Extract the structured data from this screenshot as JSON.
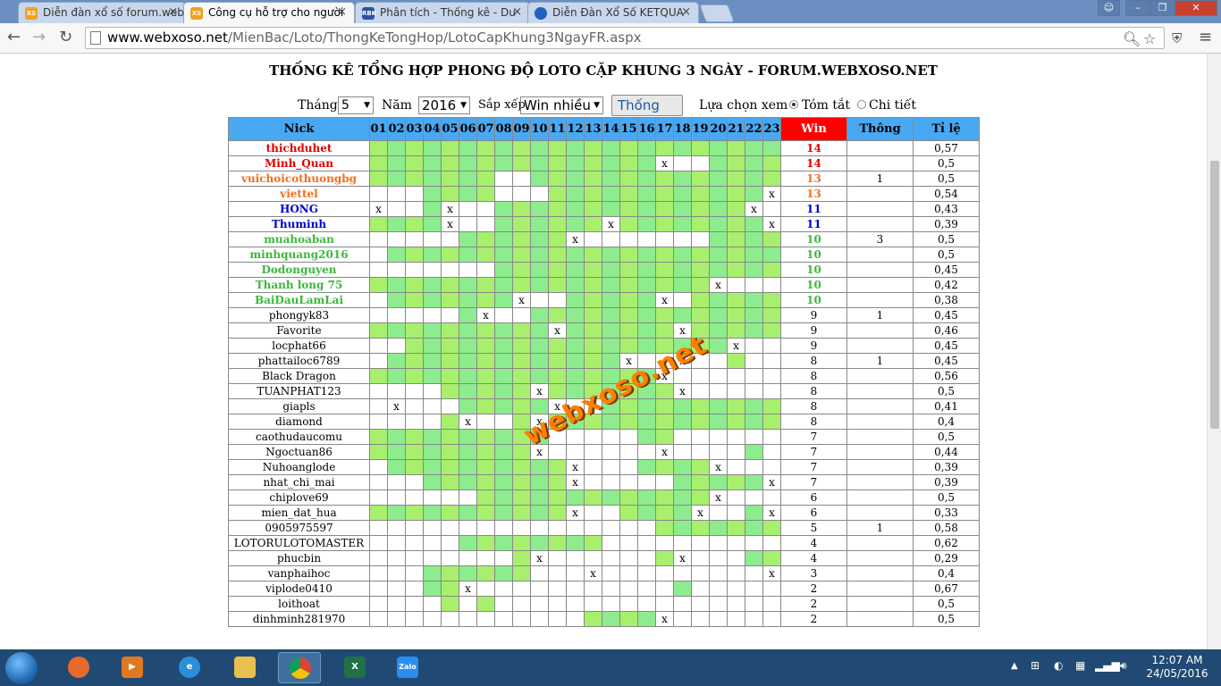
{
  "browser": {
    "tabs": [
      {
        "title": "Diễn đàn xổ số forum.web",
        "favicon": "XS",
        "color": "#f0a020",
        "active": false
      },
      {
        "title": "Công cụ hỗ trợ cho người",
        "favicon": "XS",
        "color": "#f0a020",
        "active": true
      },
      {
        "title": "Phân tích - Thống kê - Du",
        "favicon": "RBK",
        "color": "#3050a0",
        "active": false
      },
      {
        "title": "Diễn Đàn Xổ Số KETQUA",
        "favicon": "",
        "color": "#2060c0",
        "active": false
      }
    ],
    "url_host": "www.webxoso.net",
    "url_path": "/MienBac/Loto/ThongKeTongHop/LotoCapKhung3NgayFR.aspx"
  },
  "page": {
    "title": "THỐNG KÊ TỔNG HỢP PHONG ĐỘ LOTO CẶP KHUNG 3 NGÀY - FORUM.WEBXOSO.NET",
    "month_label": "Tháng",
    "month_value": "5",
    "year_label": "Năm",
    "year_value": "2016",
    "sort_label": "Sắp xếp",
    "sort_value": "Win nhiều",
    "submit_label": "Thống kê",
    "view_label": "Lựa chọn xem",
    "view_summary": "Tóm tắt",
    "view_detail": "Chi tiết",
    "watermark": "webxoso.net"
  },
  "table": {
    "headers": {
      "nick": "Nick",
      "win": "Win",
      "thong": "Thông",
      "ratio": "Tỉ lệ"
    },
    "days": [
      "01",
      "02",
      "03",
      "04",
      "05",
      "06",
      "07",
      "08",
      "09",
      "10",
      "11",
      "12",
      "13",
      "14",
      "15",
      "16",
      "17",
      "18",
      "19",
      "20",
      "21",
      "22",
      "23"
    ],
    "rows": [
      {
        "nick": "thichduhet",
        "color": "#e00000",
        "bold": true,
        "cells": "11111111111111111111112x",
        "win": "14",
        "thong": "",
        "ratio": "0,57"
      },
      {
        "nick": "Minh_Quan",
        "color": "#e00000",
        "bold": true,
        "cells": "1111111111111111x0011111",
        "win": "14",
        "thong": "",
        "ratio": "0,5"
      },
      {
        "nick": "vuichoicothuongbg",
        "color": "#f07020",
        "bold": true,
        "cells": "11111110011111111111111",
        "win": "13",
        "thong": "1",
        "ratio": "0,5"
      },
      {
        "nick": "viettel",
        "color": "#f07020",
        "bold": true,
        "cells": "0001111000111111111112x0",
        "win": "13",
        "thong": "",
        "ratio": "0,54"
      },
      {
        "nick": "HONG",
        "color": "#0000d0",
        "bold": true,
        "cells": "x001x0011111111111111x00",
        "win": "11",
        "thong": "",
        "ratio": "0,43"
      },
      {
        "nick": "Thuminh",
        "color": "#0000d0",
        "bold": true,
        "cells": "1111x00111111x11111112x0",
        "win": "11",
        "thong": "",
        "ratio": "0,39"
      },
      {
        "nick": "muahoaban",
        "color": "#3cb83c",
        "bold": true,
        "cells": "00000111111x0000000111111",
        "win": "10",
        "thong": "3",
        "ratio": "0,5"
      },
      {
        "nick": "minhquang2016",
        "color": "#3cb83c",
        "bold": true,
        "cells": "01111111111111111111112x0",
        "win": "10",
        "thong": "",
        "ratio": "0,5"
      },
      {
        "nick": "Dodonguyen",
        "color": "#3cb83c",
        "bold": true,
        "cells": "0000000111111111111111100x",
        "win": "10",
        "thong": "",
        "ratio": "0,45"
      },
      {
        "nick": "Thanh long 75",
        "color": "#3cb83c",
        "bold": true,
        "cells": "1111111111111111111x000x",
        "win": "10",
        "thong": "",
        "ratio": "0,42"
      },
      {
        "nick": "BaiDauLamLai",
        "color": "#3cb83c",
        "bold": true,
        "cells": "01111111x0011111x011111110",
        "win": "10",
        "thong": "",
        "ratio": "0,38"
      },
      {
        "nick": "phongyk83",
        "color": "#000",
        "bold": false,
        "cells": "000001x001111111111111111",
        "win": "9",
        "thong": "1",
        "ratio": "0,45"
      },
      {
        "nick": "Favorite",
        "color": "#000",
        "bold": false,
        "cells": "1111111111x111111x11111111",
        "win": "9",
        "thong": "",
        "ratio": "0,46"
      },
      {
        "nick": "locphat66",
        "color": "#000",
        "bold": false,
        "cells": "00111111111111111111x000",
        "win": "9",
        "thong": "",
        "ratio": "0,45"
      },
      {
        "nick": "phattailoc6789",
        "color": "#000",
        "bold": false,
        "cells": "01111111111111x00x001",
        "win": "8",
        "thong": "1",
        "ratio": "0,45"
      },
      {
        "nick": "Black Dragon",
        "color": "#000",
        "bold": false,
        "cells": "1111111111111111x000000",
        "win": "8",
        "thong": "",
        "ratio": "0,56"
      },
      {
        "nick": "TUANPHAT123",
        "color": "#000",
        "bold": false,
        "cells": "000011111x1111111x00000",
        "win": "8",
        "thong": "",
        "ratio": "0,5"
      },
      {
        "nick": "giapls",
        "color": "#000",
        "bold": false,
        "cells": "0x00011111x0011111111111x",
        "win": "8",
        "thong": "",
        "ratio": "0,41"
      },
      {
        "nick": "diamond",
        "color": "#000",
        "bold": false,
        "cells": "00001x001x1111111111111",
        "win": "8",
        "thong": "",
        "ratio": "0,4"
      },
      {
        "nick": "caothudaucomu",
        "color": "#000",
        "bold": false,
        "cells": "1111111111000001100000000",
        "win": "7",
        "thong": "",
        "ratio": "0,5"
      },
      {
        "nick": "Ngoctuan86",
        "color": "#000",
        "bold": false,
        "cells": "111111111x000000x0000100",
        "win": "7",
        "thong": "",
        "ratio": "0,44"
      },
      {
        "nick": "Nuhoanglode",
        "color": "#000",
        "bold": false,
        "cells": "01111111111x0001111x000000",
        "win": "7",
        "thong": "",
        "ratio": "0,39"
      },
      {
        "nick": "nhat_chi_mai",
        "color": "#000",
        "bold": false,
        "cells": "00011111111x0000011111x0",
        "win": "7",
        "thong": "",
        "ratio": "0,39"
      },
      {
        "nick": "chiplove69",
        "color": "#000",
        "bold": false,
        "cells": "0000001111111111111x00000",
        "win": "6",
        "thong": "",
        "ratio": "0,5"
      },
      {
        "nick": "mien_dat_hua",
        "color": "#000",
        "bold": false,
        "cells": "11111111111x001111x001x00",
        "win": "6",
        "thong": "",
        "ratio": "0,33"
      },
      {
        "nick": "0905975597",
        "color": "#000",
        "bold": false,
        "cells": "00000000000000001111111x0",
        "win": "5",
        "thong": "1",
        "ratio": "0,58"
      },
      {
        "nick": "LOTORULOTOMASTER",
        "color": "#000",
        "bold": false,
        "cells": "00000111111110000000000",
        "win": "4",
        "thong": "",
        "ratio": "0,62"
      },
      {
        "nick": "phucbin",
        "color": "#000",
        "bold": false,
        "cells": "000000001x0000001x00011x",
        "win": "4",
        "thong": "",
        "ratio": "0,29"
      },
      {
        "nick": "vanphaihoc",
        "color": "#000",
        "bold": false,
        "cells": "000111111000x000000000x0",
        "win": "3",
        "thong": "",
        "ratio": "0,4"
      },
      {
        "nick": "viplode0410",
        "color": "#000",
        "bold": false,
        "cells": "00011x000000000001000000",
        "win": "2",
        "thong": "",
        "ratio": "0,67"
      },
      {
        "nick": "loithoat",
        "color": "#000",
        "bold": false,
        "cells": "00001010000000000000000",
        "win": "2",
        "thong": "",
        "ratio": "0,5"
      },
      {
        "nick": "dinhminh281970",
        "color": "#000",
        "bold": false,
        "cells": "0000000000001111x000000",
        "win": "2",
        "thong": "",
        "ratio": "0,5"
      }
    ]
  },
  "taskbar": {
    "time": "12:07 AM",
    "date": "24/05/2016"
  }
}
